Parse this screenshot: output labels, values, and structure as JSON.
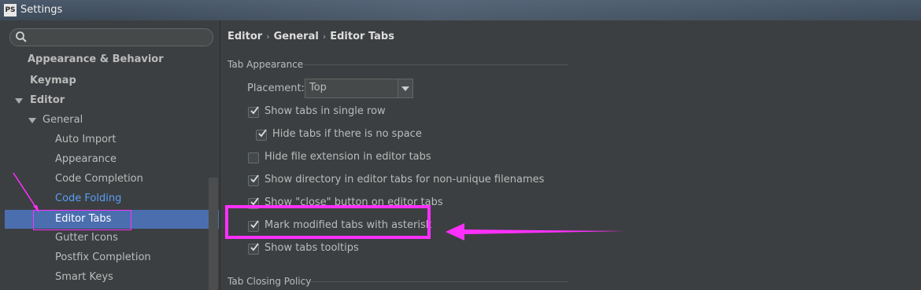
{
  "window": {
    "app_icon": "PS",
    "title": "Settings"
  },
  "search": {
    "placeholder": "",
    "value": ""
  },
  "tree": {
    "appearance_behavior": "Appearance & Behavior",
    "keymap": "Keymap",
    "editor": "Editor",
    "general": "General",
    "children": [
      "Auto Import",
      "Appearance",
      "Code Completion",
      "Code Folding",
      "Editor Tabs",
      "Gutter Icons",
      "Postfix Completion",
      "Smart Keys"
    ],
    "selected": "Editor Tabs"
  },
  "breadcrumb": [
    "Editor",
    "General",
    "Editor Tabs"
  ],
  "tab_appearance": {
    "section_title": "Tab Appearance",
    "placement_label": "Placement:",
    "placement_value": "Top",
    "options": [
      {
        "label": "Show tabs in single row",
        "checked": true
      },
      {
        "label": "Hide tabs if there is no space",
        "checked": true
      },
      {
        "label": "Hide file extension in editor tabs",
        "checked": false
      },
      {
        "label": "Show directory in editor tabs for non-unique filenames",
        "checked": true
      },
      {
        "label": "Show \"close\" button on editor tabs",
        "checked": true
      },
      {
        "label": "Mark modified tabs with asterisk",
        "checked": true
      },
      {
        "label": "Show tabs tooltips",
        "checked": true
      }
    ]
  },
  "tab_closing_policy": {
    "section_title": "Tab Closing Policy"
  },
  "colors": {
    "background": "#3c3f41",
    "selection": "#4b6eaf",
    "link": "#589df6",
    "annotation": "#ff30ff"
  }
}
